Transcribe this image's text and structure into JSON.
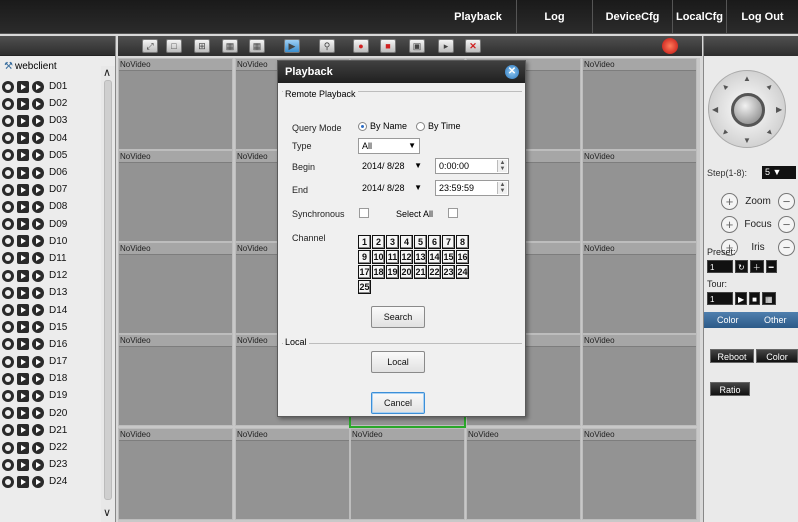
{
  "nav": {
    "playback": "Playback",
    "log": "Log",
    "devicecfg": "DeviceCfg",
    "localcfg": "LocalCfg",
    "logout": "Log Out"
  },
  "device_tree": {
    "root": "webclient",
    "channels": [
      "D01",
      "D02",
      "D03",
      "D04",
      "D05",
      "D06",
      "D07",
      "D08",
      "D09",
      "D10",
      "D11",
      "D12",
      "D13",
      "D14",
      "D15",
      "D16",
      "D17",
      "D18",
      "D19",
      "D20",
      "D21",
      "D22",
      "D23",
      "D24"
    ]
  },
  "toolbar": {
    "icons": [
      "fullscreen-icon",
      "layout-1-icon",
      "layout-4-icon",
      "layout-9-icon",
      "layout-16-icon",
      "playback-icon",
      "search-icon",
      "record-start-icon",
      "record-stop-icon",
      "snapshot-icon",
      "talk-start-icon",
      "talk-stop-icon",
      "alarm-icon"
    ]
  },
  "video": {
    "no_video": "NoVideo"
  },
  "ptz": {
    "step_label": "Step(1-8):",
    "step_value": "5",
    "zoom": "Zoom",
    "focus": "Focus",
    "iris": "Iris",
    "plus": "+",
    "minus": "−",
    "preset_label": "Preset:",
    "preset_value": "1",
    "tour_label": "Tour:",
    "tour_value": "1",
    "tab_color": "Color",
    "tab_other": "Other",
    "reboot": "Reboot",
    "color": "Color",
    "ratio": "Ratio"
  },
  "dialog": {
    "title": "Playback",
    "group_remote": "Remote Playback",
    "query_mode_label": "Query Mode",
    "by_name": "By Name",
    "by_time": "By Time",
    "type_label": "Type",
    "type_value": "All",
    "begin_label": "Begin",
    "begin_date": "2014/ 8/28",
    "begin_time": "0:00:00",
    "end_label": "End",
    "end_date": "2014/ 8/28",
    "end_time": "23:59:59",
    "synchronous_label": "Synchronous",
    "select_all_label": "Select All",
    "channel_label": "Channel",
    "channels": [
      "1",
      "2",
      "3",
      "4",
      "5",
      "6",
      "7",
      "8",
      "9",
      "10",
      "11",
      "12",
      "13",
      "14",
      "15",
      "16",
      "17",
      "18",
      "19",
      "20",
      "21",
      "22",
      "23",
      "24",
      "25"
    ],
    "search_button": "Search",
    "group_local": "Local",
    "local_button": "Local",
    "cancel_button": "Cancel"
  }
}
